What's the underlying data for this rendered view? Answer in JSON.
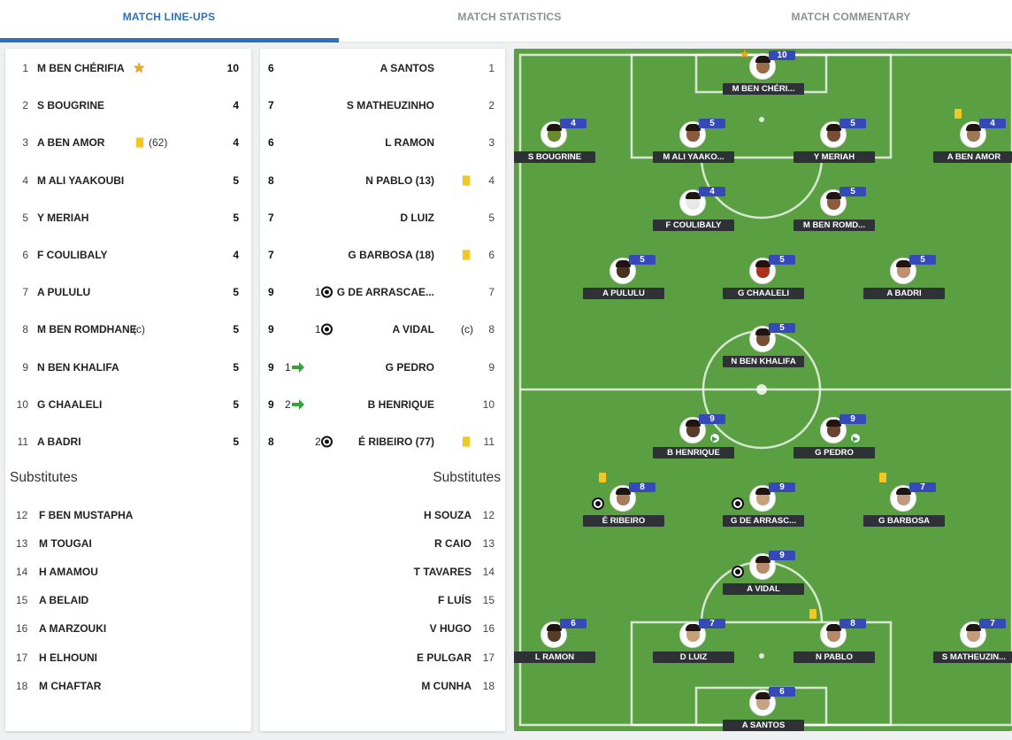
{
  "tabs": [
    {
      "label": "MATCH LINE-UPS",
      "active": true
    },
    {
      "label": "MATCH STATISTICS",
      "active": false
    },
    {
      "label": "MATCH COMMENTARY",
      "active": false
    }
  ],
  "home": {
    "players": [
      {
        "num": "1",
        "name": "M BEN CHÉRIFIA",
        "rating": "10",
        "icons": [
          "star"
        ],
        "extra": ""
      },
      {
        "num": "2",
        "name": "S BOUGRINE",
        "rating": "4",
        "icons": [],
        "extra": ""
      },
      {
        "num": "3",
        "name": "A BEN AMOR",
        "rating": "4",
        "icons": [
          "yellow-card"
        ],
        "extra": "(62)"
      },
      {
        "num": "4",
        "name": "M ALI YAAKOUBI",
        "rating": "5",
        "icons": [],
        "extra": ""
      },
      {
        "num": "5",
        "name": "Y MERIAH",
        "rating": "5",
        "icons": [],
        "extra": ""
      },
      {
        "num": "6",
        "name": "F COULIBALY",
        "rating": "4",
        "icons": [],
        "extra": ""
      },
      {
        "num": "7",
        "name": "A PULULU",
        "rating": "5",
        "icons": [],
        "extra": ""
      },
      {
        "num": "8",
        "name": "M BEN ROMDHANE",
        "rating": "5",
        "icons": [],
        "extra": "(c)"
      },
      {
        "num": "9",
        "name": "N BEN KHALIFA",
        "rating": "5",
        "icons": [],
        "extra": ""
      },
      {
        "num": "10",
        "name": "G CHAALELI",
        "rating": "5",
        "icons": [],
        "extra": ""
      },
      {
        "num": "11",
        "name": "A BADRI",
        "rating": "5",
        "icons": [],
        "extra": ""
      }
    ],
    "subs_title": "Substitutes",
    "subs": [
      {
        "num": "12",
        "name": "F BEN MUSTAPHA"
      },
      {
        "num": "13",
        "name": "M TOUGAI"
      },
      {
        "num": "14",
        "name": "H AMAMOU"
      },
      {
        "num": "15",
        "name": "A BELAID"
      },
      {
        "num": "16",
        "name": "A MARZOUKI"
      },
      {
        "num": "17",
        "name": "H ELHOUNI"
      },
      {
        "num": "18",
        "name": "M CHAFTAR"
      }
    ]
  },
  "away": {
    "players": [
      {
        "num": "1",
        "name": "A SANTOS",
        "rating": "6",
        "pre": "",
        "icon": "",
        "post": ""
      },
      {
        "num": "2",
        "name": "S MATHEUZINHO",
        "rating": "7",
        "pre": "",
        "icon": "",
        "post": ""
      },
      {
        "num": "3",
        "name": "L RAMON",
        "rating": "6",
        "pre": "",
        "icon": "",
        "post": ""
      },
      {
        "num": "4",
        "name": "N PABLO (13)",
        "rating": "8",
        "pre": "",
        "icon": "",
        "post": "yellow-card"
      },
      {
        "num": "5",
        "name": "D LUIZ",
        "rating": "7",
        "pre": "",
        "icon": "",
        "post": ""
      },
      {
        "num": "6",
        "name": "G BARBOSA (18)",
        "rating": "7",
        "pre": "",
        "icon": "",
        "post": "yellow-card"
      },
      {
        "num": "7",
        "name": "G DE ARRASCAE...",
        "rating": "9",
        "pre": "1",
        "icon": "ball",
        "post": ""
      },
      {
        "num": "8",
        "name": "A VIDAL",
        "rating": "9",
        "pre": "1",
        "icon": "ball",
        "post": "(c)"
      },
      {
        "num": "9",
        "name": "G PEDRO",
        "rating": "9",
        "pre": "1",
        "icon": "sub",
        "post": ""
      },
      {
        "num": "10",
        "name": "B HENRIQUE",
        "rating": "9",
        "pre": "2",
        "icon": "sub",
        "post": ""
      },
      {
        "num": "11",
        "name": "É RIBEIRO (77)",
        "rating": "8",
        "pre": "2",
        "icon": "ball",
        "post": "yellow-card"
      }
    ],
    "subs_title": "Substitutes",
    "subs": [
      {
        "num": "12",
        "name": "H SOUZA"
      },
      {
        "num": "13",
        "name": "R CAIO"
      },
      {
        "num": "14",
        "name": "T TAVARES"
      },
      {
        "num": "15",
        "name": "F LUÍS"
      },
      {
        "num": "16",
        "name": "V HUGO"
      },
      {
        "num": "17",
        "name": "E PULGAR"
      },
      {
        "num": "18",
        "name": "M CUNHA"
      }
    ]
  },
  "pitch": {
    "players": [
      {
        "name": "M BEN CHÉRI...",
        "rating": "10",
        "team": "home",
        "skin": "#9a6a4a",
        "icons": [
          "star"
        ]
      },
      {
        "name": "S BOUGRINE",
        "rating": "4",
        "team": "home",
        "skin": "#6b8a2c",
        "icons": []
      },
      {
        "name": "M ALI YAAKO...",
        "rating": "5",
        "team": "home",
        "skin": "#8a5a3a",
        "icons": []
      },
      {
        "name": "Y MERIAH",
        "rating": "5",
        "team": "home",
        "skin": "#7a4e36",
        "icons": []
      },
      {
        "name": "A BEN AMOR",
        "rating": "4",
        "team": "home",
        "skin": "#a07858",
        "icons": [
          "yellow-card"
        ]
      },
      {
        "name": "F COULIBALY",
        "rating": "4",
        "team": "home",
        "skin": "#e8e8e8",
        "icons": []
      },
      {
        "name": "M BEN ROMD...",
        "rating": "5",
        "team": "home",
        "skin": "#8e5c3c",
        "icons": []
      },
      {
        "name": "A PULULU",
        "rating": "5",
        "team": "home",
        "skin": "#4a3020",
        "icons": []
      },
      {
        "name": "G CHAALELI",
        "rating": "5",
        "team": "home",
        "skin": "#b03020",
        "icons": []
      },
      {
        "name": "A BADRI",
        "rating": "5",
        "team": "home",
        "skin": "#c09070",
        "icons": []
      },
      {
        "name": "N BEN KHALIFA",
        "rating": "5",
        "team": "home",
        "skin": "#7a4e34",
        "icons": []
      },
      {
        "name": "B HENRIQUE",
        "rating": "9",
        "team": "away",
        "skin": "#5a3a28",
        "icons": [
          "sub"
        ]
      },
      {
        "name": "G PEDRO",
        "rating": "9",
        "team": "away",
        "skin": "#6a4430",
        "icons": [
          "sub"
        ]
      },
      {
        "name": "É RIBEIRO",
        "rating": "8",
        "team": "away",
        "skin": "#a87c5c",
        "icons": [
          "yellow-card",
          "ball"
        ]
      },
      {
        "name": "G DE ARRASC...",
        "rating": "9",
        "team": "away",
        "skin": "#c8a080",
        "icons": [
          "ball"
        ]
      },
      {
        "name": "G BARBOSA",
        "rating": "7",
        "team": "away",
        "skin": "#c09a80",
        "icons": [
          "yellow-card"
        ]
      },
      {
        "name": "A VIDAL",
        "rating": "9",
        "team": "away",
        "skin": "#b88a68",
        "icons": [
          "ball"
        ]
      },
      {
        "name": "L RAMON",
        "rating": "6",
        "team": "away",
        "skin": "#5a3c2a",
        "icons": []
      },
      {
        "name": "D LUIZ",
        "rating": "7",
        "team": "away",
        "skin": "#c8a078",
        "icons": []
      },
      {
        "name": "N PABLO",
        "rating": "8",
        "team": "away",
        "skin": "#b88868",
        "icons": [
          "yellow-card"
        ]
      },
      {
        "name": "S MATHEUZIN...",
        "rating": "7",
        "team": "away",
        "skin": "#c49c7c",
        "icons": []
      },
      {
        "name": "A SANTOS",
        "rating": "6",
        "team": "away",
        "skin": "#c8a284",
        "icons": []
      }
    ]
  },
  "colors": {
    "accent": "#2d71b8",
    "rating_badge": "#3549b8",
    "name_plate": "#2e3236",
    "pitch": "#5aa042",
    "yellow_card": "#f3c921"
  }
}
